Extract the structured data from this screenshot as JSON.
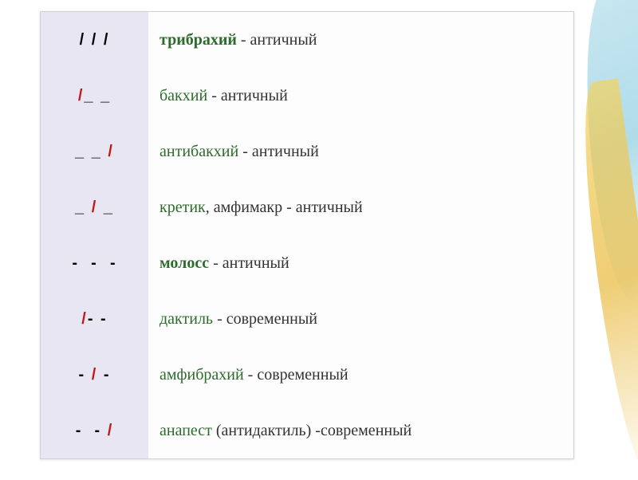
{
  "rows": [
    {
      "pattern_html": "<span class='pat-black'>/ / /</span>",
      "term": "трибрахий",
      "term_style": "term-green",
      "extra": "",
      "suffix": " - античный"
    },
    {
      "pattern_html": "<span class='pat-red'>/</span> <span class='pat-black'>_ _</span>",
      "term": "бакхий",
      "term_style": "term-green-plain",
      "extra": "",
      "suffix": " - античный"
    },
    {
      "pattern_html": "<span class='pat-black'>_ _</span>&nbsp; <span class='pat-red'>/</span>",
      "term": "антибакхий",
      "term_style": "term-green-plain",
      "extra": "",
      "suffix": " - античный"
    },
    {
      "pattern_html": "<span class='pat-black'>_</span>&nbsp; <span class='pat-red'>/</span>&nbsp; <span class='pat-black'>_</span>",
      "term": "кретик",
      "term_style": "term-green-plain",
      "extra": ", амфимакр",
      "suffix": " - античный"
    },
    {
      "pattern_html": "<span class='pat-black'>-&nbsp; -&nbsp; -</span>",
      "term": "молосс",
      "term_style": "term-green",
      "extra": "",
      "suffix": " - античный"
    },
    {
      "pattern_html": "<span class='pat-red'>/</span> <span class='pat-black'>- -</span>",
      "term": "дактиль",
      "term_style": "term-green-plain",
      "extra": "",
      "suffix": " - современный"
    },
    {
      "pattern_html": "<span class='pat-black'>-</span>&nbsp; <span class='pat-red'>/</span>&nbsp; <span class='pat-black'>-</span>",
      "term": "амфибрахий",
      "term_style": "term-green-plain",
      "extra": "",
      "suffix": " - современный"
    },
    {
      "pattern_html": "<span class='pat-black'>-&nbsp; -</span>&nbsp; <span class='pat-red'>/</span>",
      "term": "анапест",
      "term_style": "term-green-plain",
      "extra": " (антидактиль)",
      "suffix": " -современный"
    }
  ]
}
